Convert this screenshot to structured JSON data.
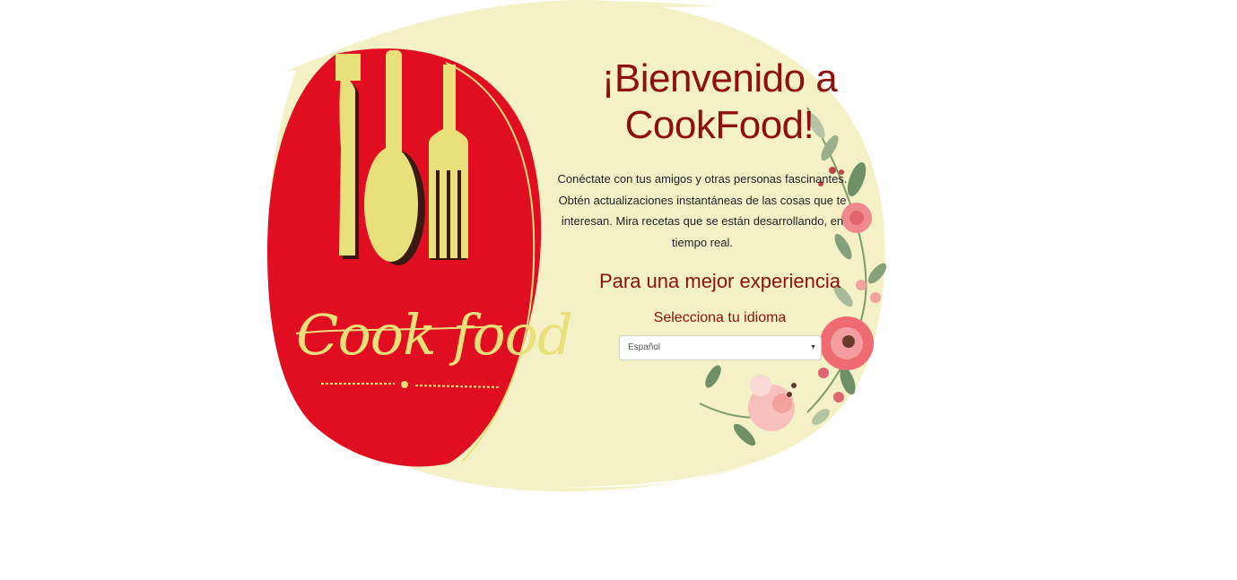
{
  "welcome": {
    "title_line1": "¡Bienvenido a",
    "title_line2": "CookFood!",
    "description": "Conéctate con tus amigos y otras personas fascinantes. Obtén actualizaciones instantáneas de las cosas que te interesan. Mira recetas que se están desarrollando, en tiempo real."
  },
  "language": {
    "heading": "Para una mejor experiencia",
    "label": "Selecciona tu idioma",
    "selected": "Español"
  },
  "logo": {
    "text": "Cook food"
  },
  "colors": {
    "background_blob": "#f3f1c5",
    "logo_red": "#e10e22",
    "logo_yellow": "#e8e07a",
    "title_red": "#8f0f0f"
  }
}
